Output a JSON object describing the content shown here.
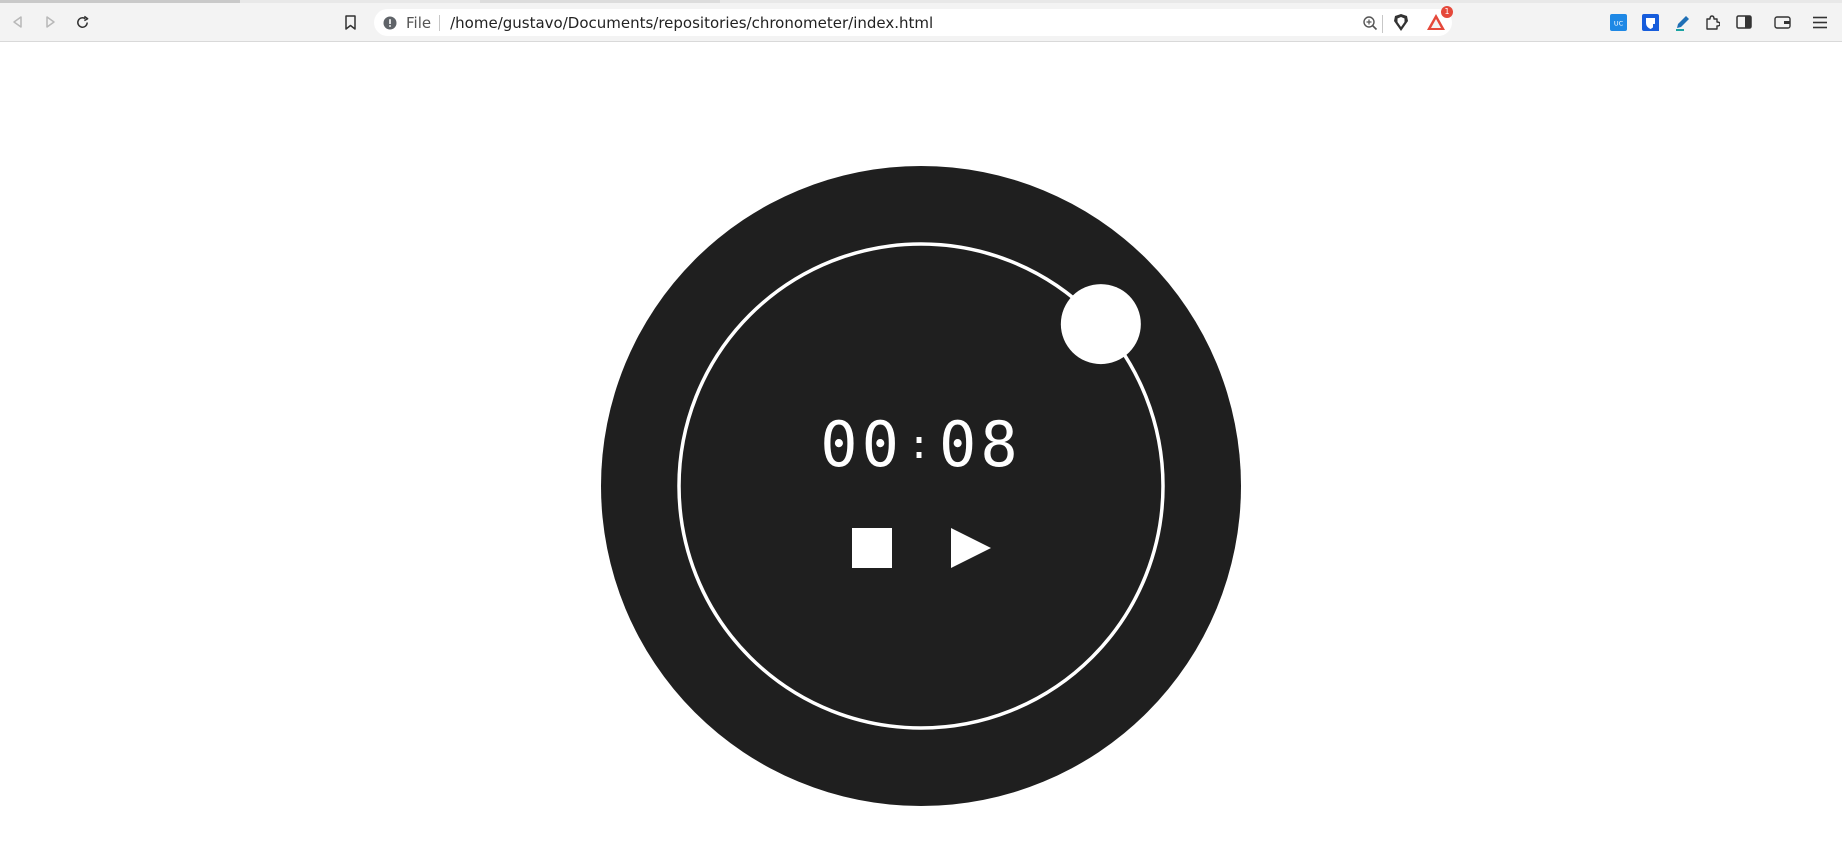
{
  "browser": {
    "address": {
      "scheme": "File",
      "url": "/home/gustavo/Documents/repositories/chronometer/index.html"
    },
    "notifications_badge": "1",
    "icons": [
      "back-icon",
      "forward-icon",
      "reload-icon",
      "bookmark-icon",
      "info-icon",
      "zoom-icon",
      "brave-shield-icon",
      "brave-rewards-icon",
      "extension-uc-icon",
      "extension-bitwarden-icon",
      "extension-pen-icon",
      "extensions-puzzle-icon",
      "sidebar-icon",
      "wallet-icon",
      "menu-icon"
    ]
  },
  "chronometer": {
    "minutes": "00",
    "separator": ":",
    "seconds": "08",
    "elapsed_seconds": 8,
    "colors": {
      "body": "#1f1f1f",
      "accent": "#ffffff"
    }
  }
}
